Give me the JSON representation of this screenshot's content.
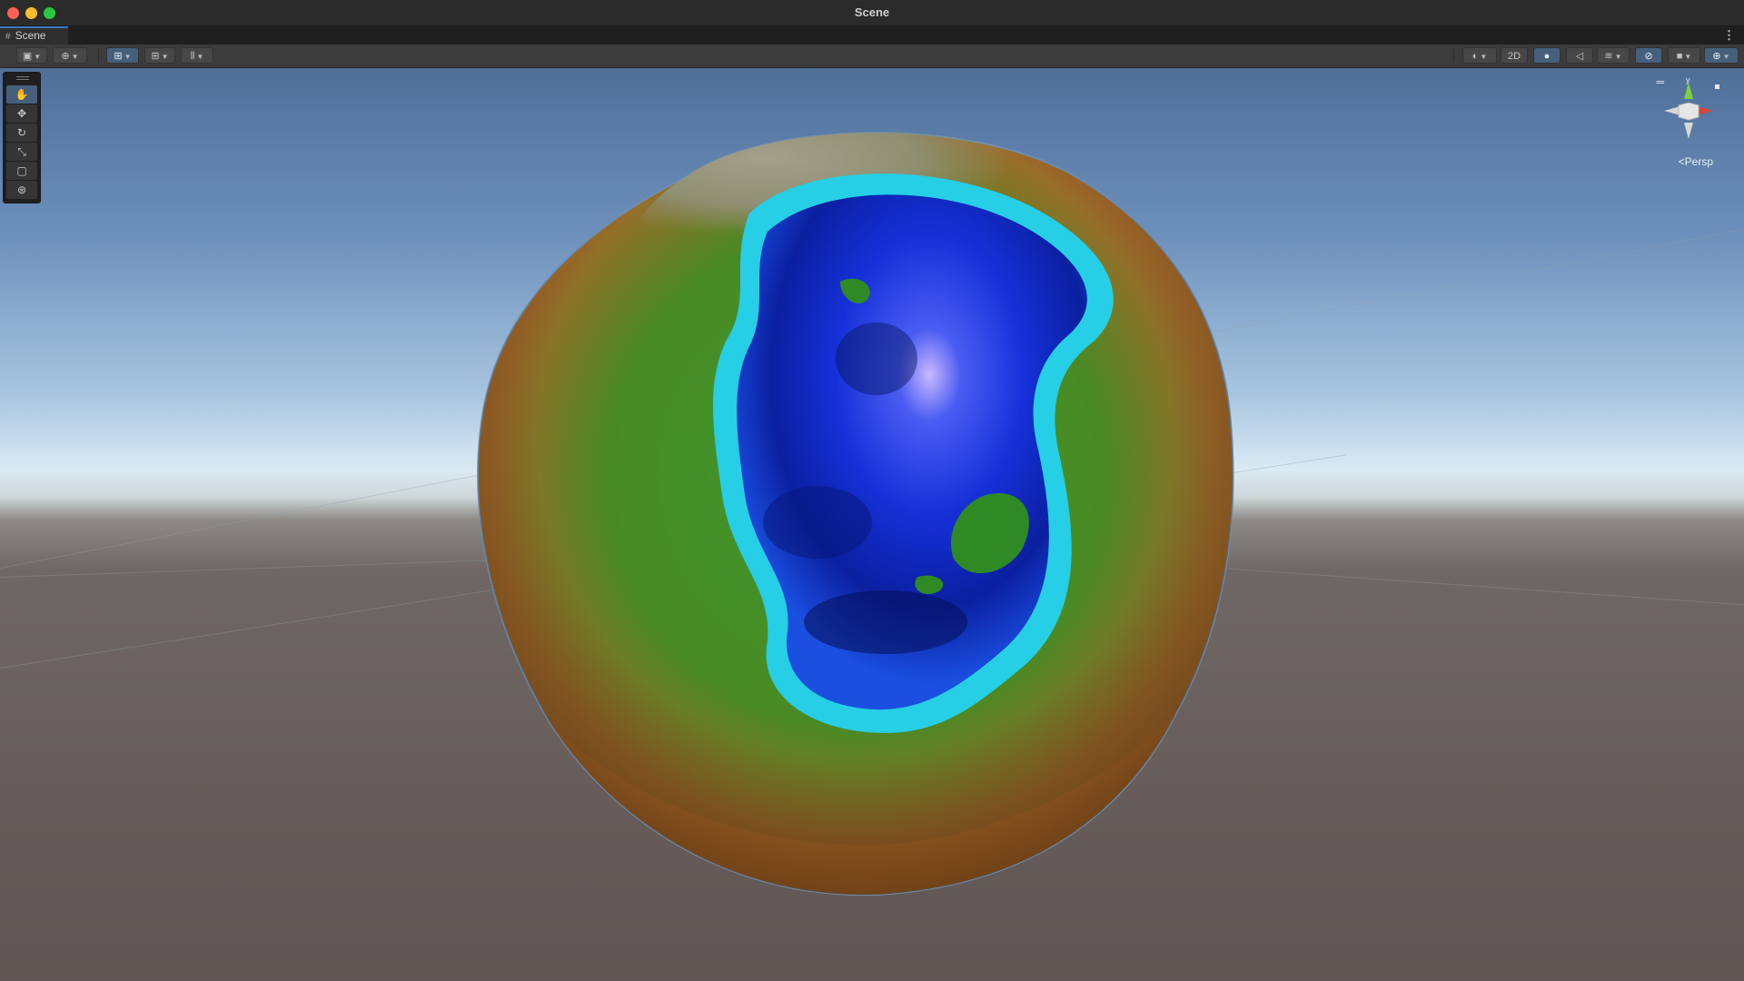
{
  "window": {
    "title": "Scene"
  },
  "tab": {
    "label": "Scene",
    "icon": "grid-icon",
    "menu": "⋮"
  },
  "toolbar": {
    "left": [
      {
        "name": "draw-mode",
        "icon": "draw-mode-icon",
        "glyph": "▣"
      },
      {
        "name": "global-handle",
        "icon": "globe-icon",
        "glyph": "⊕"
      },
      {
        "name": "snap-to-grid",
        "icon": "snap-grid-icon",
        "glyph": "⊞",
        "active": true
      },
      {
        "name": "grid-visibility",
        "icon": "grid-icon",
        "glyph": "⊞"
      },
      {
        "name": "increment-snap",
        "icon": "increment-snap-icon",
        "glyph": "⫴"
      }
    ],
    "right": [
      {
        "name": "shading-mode",
        "icon": "shading-sphere-icon",
        "glyph": "◐"
      },
      {
        "name": "toggle-2d",
        "label": "2D"
      },
      {
        "name": "lighting",
        "icon": "light-bulb-icon",
        "glyph": "💡",
        "active": true
      },
      {
        "name": "audio",
        "icon": "audio-mute-icon",
        "glyph": "🔇"
      },
      {
        "name": "effects",
        "icon": "effects-icon",
        "glyph": "≋"
      },
      {
        "name": "hidden-objects",
        "icon": "eye-off-icon",
        "glyph": "⊘",
        "active": true
      },
      {
        "name": "camera",
        "icon": "camera-icon",
        "glyph": "■"
      },
      {
        "name": "gizmos",
        "icon": "gizmos-icon",
        "glyph": "⊕",
        "active": true
      }
    ]
  },
  "tools": [
    {
      "name": "view-tool",
      "icon": "hand-icon",
      "glyph": "✋",
      "active": true
    },
    {
      "name": "move-tool",
      "icon": "move-icon",
      "glyph": "✥"
    },
    {
      "name": "rotate-tool",
      "icon": "rotate-icon",
      "glyph": "↻"
    },
    {
      "name": "scale-tool",
      "icon": "scale-icon",
      "glyph": "⤡"
    },
    {
      "name": "rect-tool",
      "icon": "rect-icon",
      "glyph": "▢"
    },
    {
      "name": "transform-tool",
      "icon": "transform-icon",
      "glyph": "⊛"
    }
  ],
  "gizmo": {
    "axis_label": "y",
    "projection_label": "Persp",
    "projection_prefix": "<"
  },
  "colors": {
    "accent": "#46607c",
    "sky_top": "#4f6f99",
    "horizon": "#dbeaf3",
    "ground": "#5f5552",
    "ocean_deep": "#0a2bb0",
    "ocean_shallow": "#2ad0e8",
    "land_green": "#2f8a25",
    "land_brown": "#b86b2a"
  }
}
